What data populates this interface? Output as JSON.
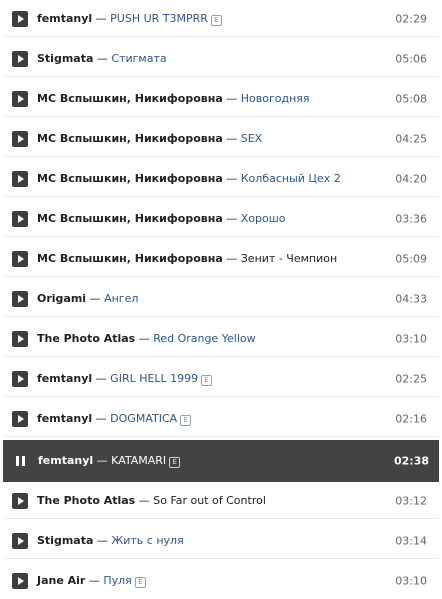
{
  "tracks": [
    {
      "artist": "femtanyl",
      "title": "PUSH UR T3MPRR",
      "explicit": true,
      "duration": "02:29"
    },
    {
      "artist": "Stigmata",
      "title": "Стигмата",
      "explicit": false,
      "duration": "05:06"
    },
    {
      "artist": "MC Вспышкин, Никифоровна",
      "title": "Новогодняя",
      "explicit": false,
      "duration": "05:08"
    },
    {
      "artist": "MC Вспышкин, Никифоровна",
      "title": "SEX",
      "explicit": false,
      "duration": "04:25"
    },
    {
      "artist": "MC Вспышкин, Никифоровна",
      "title": "Колбасный Цех 2",
      "explicit": false,
      "duration": "04:20"
    },
    {
      "artist": "MC Вспышкин, Никифоровна",
      "title": "Хорошо",
      "explicit": false,
      "duration": "03:36"
    },
    {
      "artist": "MC Вспышкин, Никифоровна",
      "title": "Зенит - Чемпион",
      "explicit": false,
      "duration": "05:09"
    },
    {
      "artist": "Origami",
      "title": "Ангел",
      "explicit": false,
      "duration": "04:33"
    },
    {
      "artist": "The Photo Atlas",
      "title": "Red Orange Yellow",
      "explicit": false,
      "duration": "03:10"
    },
    {
      "artist": "femtanyl",
      "title": "GIRL HELL 1999",
      "explicit": true,
      "duration": "02:25"
    },
    {
      "artist": "femtanyl",
      "title": "DOGMATICA",
      "explicit": true,
      "duration": "02:16"
    },
    {
      "artist": "femtanyl",
      "title": "KATAMARI",
      "explicit": true,
      "duration": "02:38",
      "playing": true
    },
    {
      "artist": "The Photo Atlas",
      "title": "So Far out of Control",
      "explicit": false,
      "duration": "03:12"
    },
    {
      "artist": "Stigmata",
      "title": "Жить с нуля",
      "explicit": false,
      "duration": "03:14"
    },
    {
      "artist": "Jane Air",
      "title": "Пуля",
      "explicit": true,
      "duration": "03:10"
    }
  ],
  "dash": "—",
  "explicit_mark": "E",
  "colors": {
    "link": "#2a5885",
    "playing_bg": "#434343",
    "button": "#3e3e3e",
    "duration": "#656565"
  }
}
